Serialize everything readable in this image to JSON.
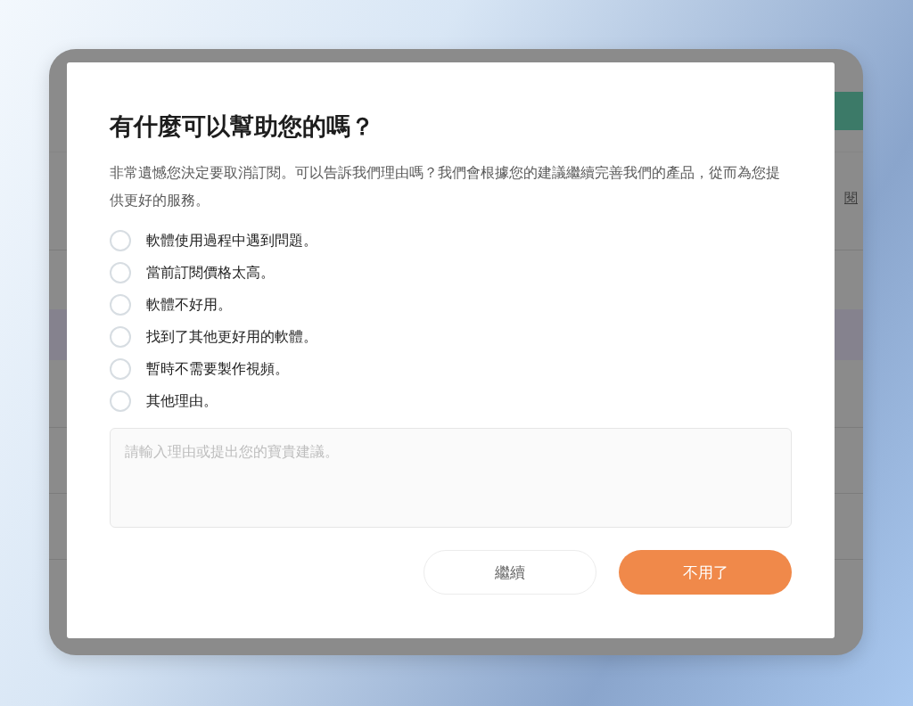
{
  "background_page": {
    "link_text": "閱"
  },
  "dialog": {
    "title": "有什麼可以幫助您的嗎？",
    "message": "非常遺憾您決定要取消訂閱。可以告訴我們理由嗎？我們會根據您的建議繼續完善我們的產品，從而為您提供更好的服務。",
    "reasons": [
      {
        "label": "軟體使用過程中遇到問題。",
        "selected": false
      },
      {
        "label": "當前訂閱價格太高。",
        "selected": false
      },
      {
        "label": "軟體不好用。",
        "selected": false
      },
      {
        "label": "找到了其他更好用的軟體。",
        "selected": false
      },
      {
        "label": "暫時不需要製作視頻。",
        "selected": false
      },
      {
        "label": "其他理由。",
        "selected": false
      }
    ],
    "feedback": {
      "placeholder": "請輸入理由或提出您的寶貴建議。"
    },
    "buttons": [
      {
        "label": "繼續",
        "kind": "secondary"
      },
      {
        "label": "不用了",
        "kind": "primary"
      }
    ]
  }
}
